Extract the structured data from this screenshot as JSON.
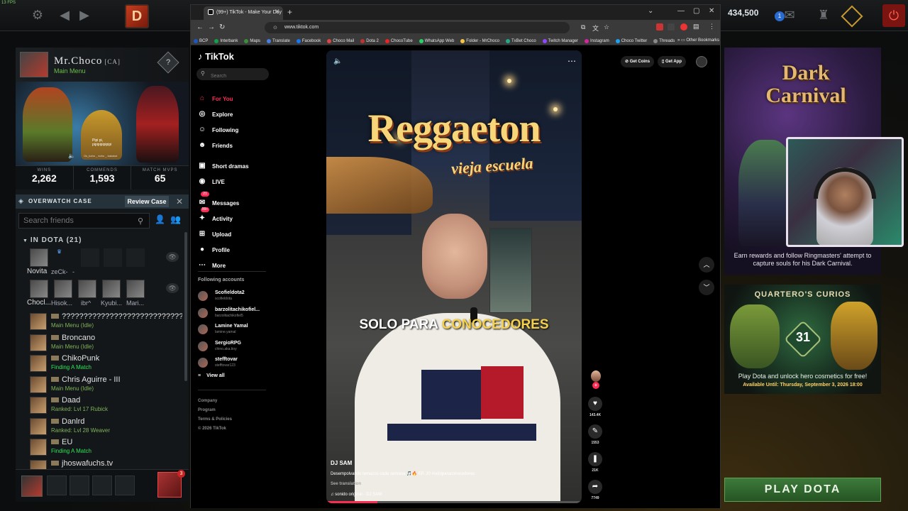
{
  "dota": {
    "fps": "13 FPS",
    "currency": "434,500",
    "currency2_badge": "1",
    "profile": {
      "name": "Mr.Choco",
      "tag": "[CA]",
      "status": "Main Menu",
      "bubble_line1": "Pipi pi,",
      "bubble_line2": "pipipipipipipi",
      "bubble_line3": "Os_koho _ koho _ kakokot",
      "stats": [
        {
          "label": "WINS",
          "value": "2,262"
        },
        {
          "label": "COMMENDS",
          "value": "1,593"
        },
        {
          "label": "MATCH MVPS",
          "value": "65"
        }
      ]
    },
    "overwatch": {
      "label": "OVERWATCH CASE",
      "button": "Review Case"
    },
    "friends": {
      "search_placeholder": "Search friends",
      "group_header": "IN DOTA (21)",
      "party1": [
        {
          "name": "Novita"
        },
        {
          "name": "zeCk-"
        },
        {
          "name": "-"
        }
      ],
      "party2": [
        {
          "name": "Chocl..."
        },
        {
          "name": "Hisok..."
        },
        {
          "name": "ibr^"
        },
        {
          "name": "Kyubi..."
        },
        {
          "name": "Mari..."
        }
      ],
      "list": [
        {
          "name": "????????????????????????????",
          "status": "Main Menu (Idle)",
          "green": false
        },
        {
          "name": "Broncano",
          "status": "Main Menu (Idle)",
          "green": false
        },
        {
          "name": "ChikoPunk",
          "status": "Finding A Match",
          "green": true
        },
        {
          "name": "Chris Aguirre - III",
          "status": "Main Menu (Idle)",
          "green": false
        },
        {
          "name": "Daad",
          "status": "Ranked: Lvl 17 Rubick",
          "green": false
        },
        {
          "name": "Danlrd",
          "status": "Ranked: Lvl 28 Weaver",
          "green": false
        },
        {
          "name": "EU",
          "status": "Finding A Match",
          "green": true
        },
        {
          "name": "jhoswafuchs.tv",
          "status": "",
          "green": false
        }
      ]
    },
    "party_badge": "3",
    "dark_carnival": {
      "title_line1": "Dark",
      "title_line2": "Carnival",
      "desc": "Earn rewards and follow Ringmasters' attempt to capture souls for his Dark Carnival."
    },
    "quartero": {
      "title": "QUARTERO'S CURIOS",
      "number": "31",
      "desc": "Play Dota and unlock hero cosmetics for free!",
      "until": "Available Until: Thursday, September 3, 2026 18:00"
    },
    "play_button": "PLAY DOTA"
  },
  "browser": {
    "tab_title": "(99+) TikTok - Make Your Day",
    "url": "www.tiktok.com",
    "bookmarks": [
      {
        "label": "BCP",
        "color": "#1f57c2"
      },
      {
        "label": "Interbank",
        "color": "#12a14a"
      },
      {
        "label": "Maps",
        "color": "#3a8e3a"
      },
      {
        "label": "Translate",
        "color": "#4a7de0"
      },
      {
        "label": "Facebook",
        "color": "#1877f2"
      },
      {
        "label": "Choco Mail",
        "color": "#d44"
      },
      {
        "label": "Dota 2",
        "color": "#b33"
      },
      {
        "label": "ChocoTube",
        "color": "#e22"
      },
      {
        "label": "WhatsApp Web",
        "color": "#25d366"
      },
      {
        "label": "Folder - MrChoco",
        "color": "#f4c542"
      },
      {
        "label": "TxBet Choco",
        "color": "#2a8"
      },
      {
        "label": "Twitch Manager",
        "color": "#9146ff"
      },
      {
        "label": "Instagram",
        "color": "#d6249f"
      },
      {
        "label": "Choco Twitter",
        "color": "#1da1f2"
      },
      {
        "label": "Threads",
        "color": "#888"
      }
    ],
    "other_bookmarks": "Other Bookmarks"
  },
  "tiktok": {
    "logo": "TikTok",
    "search_placeholder": "Search",
    "nav": [
      {
        "label": "For You",
        "icon": "home-icon",
        "glyph": "⌂",
        "active": true
      },
      {
        "label": "Explore",
        "icon": "compass-icon",
        "glyph": "◎",
        "active": false
      },
      {
        "label": "Following",
        "icon": "following-icon",
        "glyph": "☺",
        "active": false
      },
      {
        "label": "Friends",
        "icon": "friends-icon",
        "glyph": "☻",
        "active": false
      },
      {
        "label": "Short dramas",
        "icon": "dramas-icon",
        "glyph": "▣",
        "active": false
      },
      {
        "label": "LIVE",
        "icon": "live-icon",
        "glyph": "◉",
        "active": false
      },
      {
        "label": "Messages",
        "icon": "messages-icon",
        "glyph": "✉",
        "active": false
      },
      {
        "label": "Activity",
        "icon": "activity-icon",
        "glyph": "✦",
        "active": false
      },
      {
        "label": "Upload",
        "icon": "upload-icon",
        "glyph": "⊞",
        "active": false
      },
      {
        "label": "Profile",
        "icon": "profile-icon",
        "glyph": "●",
        "active": false
      },
      {
        "label": "More",
        "icon": "more-icon",
        "glyph": "⋯",
        "active": false
      }
    ],
    "messages_badge": "21",
    "activity_badge": "99+",
    "following_title": "Following accounts",
    "following": [
      {
        "name": "Scofieldota2",
        "handle": "scofieldota"
      },
      {
        "name": "barzolitachikofiel...",
        "handle": "barzolitachikofiel5"
      },
      {
        "name": "Lamine Yamal",
        "handle": "lamine.yamal"
      },
      {
        "name": "SergioRPG",
        "handle": "chino.aka.tioy"
      },
      {
        "name": "stefftovar",
        "handle": "stefftovar123"
      }
    ],
    "view_all": "View all",
    "footer": [
      "Company",
      "Program",
      "Terms & Policies",
      "© 2026 TikTok"
    ],
    "get_coins": "Get Coins",
    "get_app": "Get App",
    "video": {
      "title": "Reggaeton",
      "subtitle": "vieja escuela",
      "caption_white": "SOLO PARA ",
      "caption_yellow": "CONOCEDORES",
      "author": "DJ SAM",
      "description": "Desempolvando temazos cada semana 🎵🔥 EP. 20 #soloparaconocedores",
      "see_translation": "See translation",
      "music": "♫  sonido original - DJ SAM",
      "progress": 0.2
    },
    "actions": [
      {
        "icon": "heart-icon",
        "glyph": "♥",
        "count": "143.4K"
      },
      {
        "icon": "comment-icon",
        "glyph": "✎",
        "count": "1553"
      },
      {
        "icon": "bookmark-icon",
        "glyph": "❚",
        "count": "21K"
      },
      {
        "icon": "share-icon",
        "glyph": "➦",
        "count": "7749"
      }
    ]
  }
}
